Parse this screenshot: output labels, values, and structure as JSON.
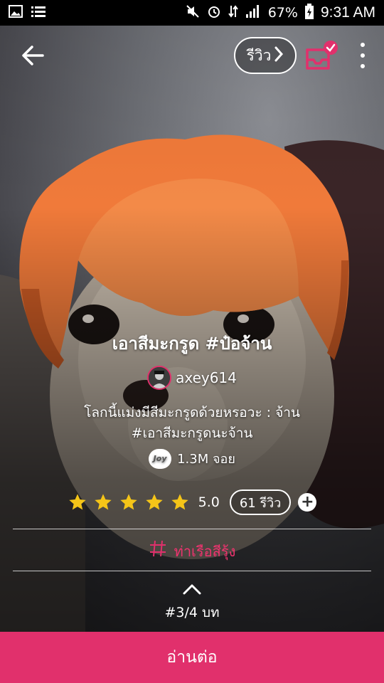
{
  "status_bar": {
    "battery": "67%",
    "time": "9:31 AM"
  },
  "header": {
    "review_label": "รีวิว"
  },
  "story": {
    "title": "เอาสีมะกรูด #ป๋อจ้าน",
    "author": "axey614",
    "description_line1": "โลกนี้แม่งมีสีมะกรูดด้วยหรอวะ : จ้าน",
    "description_line2": "#เอาสีมะกรูดนะจ้าน",
    "joy_badge": "Joy",
    "joy_count": "1.3M จอย",
    "rating_value": "5.0",
    "star_count": 5,
    "reviews_label": "61 รีวิว",
    "tag": "ท่าเรือสีรุ้ง",
    "chapter": "#3/4 บท"
  },
  "footer": {
    "read_label": "อ่านต่อ"
  },
  "colors": {
    "accent": "#e1306c",
    "star": "#f5c518"
  },
  "icons": [
    "back-arrow-icon",
    "chevron-right-icon",
    "inbox-check-icon",
    "more-vertical-icon",
    "star-icon",
    "plus-icon",
    "hashtag-icon",
    "chevron-up-icon"
  ]
}
